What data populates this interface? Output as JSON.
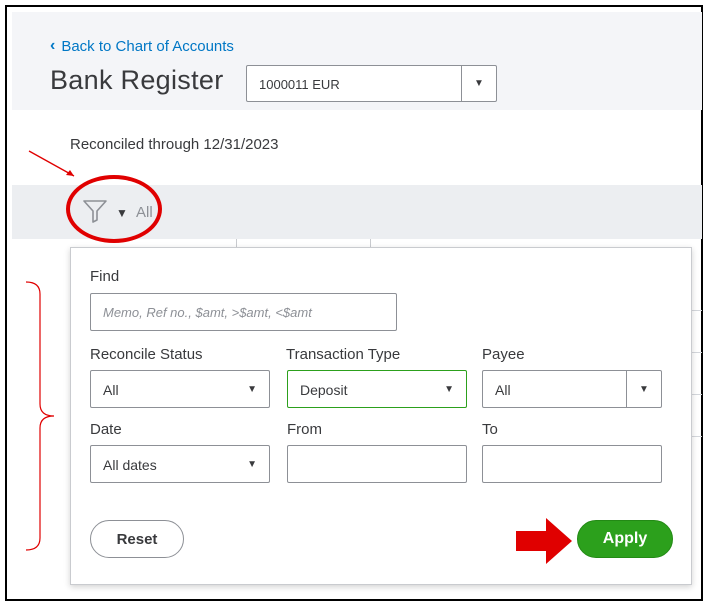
{
  "header": {
    "back_link": "Back to Chart of Accounts",
    "title": "Bank Register",
    "account_value": "1000011 EUR"
  },
  "reconciled_text": "Reconciled through 12/31/2023",
  "filter_bar": {
    "value": "All",
    "icon": "funnel-icon"
  },
  "filter_panel": {
    "find": {
      "label": "Find",
      "placeholder": "Memo, Ref no., $amt, >$amt, <$amt",
      "value": ""
    },
    "reconcile_status": {
      "label": "Reconcile Status",
      "value": "All"
    },
    "transaction_type": {
      "label": "Transaction Type",
      "value": "Deposit"
    },
    "payee": {
      "label": "Payee",
      "value": "All"
    },
    "date": {
      "label": "Date",
      "value": "All dates"
    },
    "from": {
      "label": "From",
      "value": ""
    },
    "to": {
      "label": "To",
      "value": ""
    },
    "reset_label": "Reset",
    "apply_label": "Apply"
  },
  "colors": {
    "accent_green": "#2ca01c",
    "link_blue": "#0077c5",
    "annotation_red": "#e00000"
  }
}
